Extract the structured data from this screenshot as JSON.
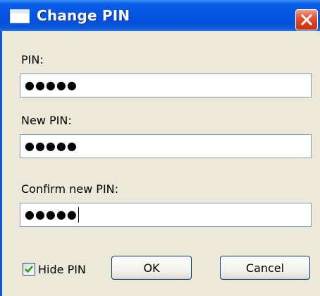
{
  "window": {
    "title": "Change PIN",
    "title_icon": "window-icon",
    "close_icon": "close-icon"
  },
  "fields": [
    {
      "label": "PIN:",
      "value": "●●●●●",
      "masked": true
    },
    {
      "label": "New PIN:",
      "value": "●●●●●",
      "masked": true
    },
    {
      "label": "Confirm new PIN:",
      "value": "●●●●●",
      "masked": true,
      "focused": true
    }
  ],
  "hide_pin": {
    "label": "Hide PIN",
    "checked": true
  },
  "buttons": {
    "ok_label": "OK",
    "cancel_label": "Cancel"
  },
  "colors": {
    "titlebar": "#0554e3",
    "dialog_background": "#ece9d8",
    "close_button": "#d53c1c",
    "field_border": "#7f9db9"
  }
}
